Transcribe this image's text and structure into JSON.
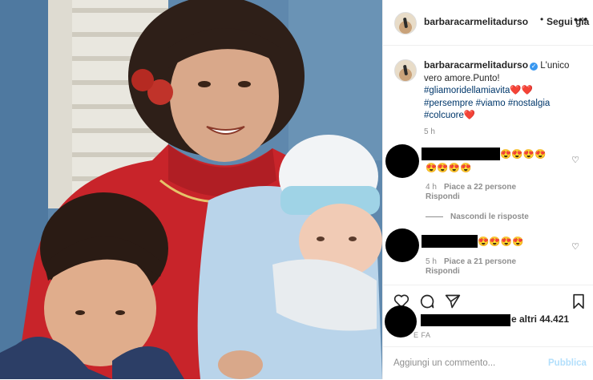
{
  "post": {
    "username": "barbaracarmelitadurso",
    "follow_separator": "•",
    "follow_label": "Segui già",
    "more_label": "•••"
  },
  "caption": {
    "username": "barbaracarmelitadurso",
    "verified_glyph": "✓",
    "text": "L'unico vero amore.Punto!",
    "hashtag1": "#gliamoridellamiavita",
    "hashtag1_emoji": "❤️❤️",
    "hashtag2": "#persempre",
    "hashtag3": "#viamo",
    "hashtag4": "#nostalgia",
    "hashtag5": "#colcuore",
    "hashtag5_emoji": "❤️",
    "time": "5 h"
  },
  "comments": [
    {
      "emoji_line1": "😍😍😍😍",
      "emoji_line2": "😍😍😍😍",
      "time": "4 h",
      "likes": "Piace a 22 persone",
      "reply": "Rispondi"
    },
    {
      "emoji_line1": "😍😍😍😍",
      "time": "5 h",
      "likes": "Piace a 21 persone",
      "reply": "Rispondi"
    }
  ],
  "hide_replies": "Nascondi le risposte",
  "likes_summary": "e altri 44.421",
  "time_ago": "E FA",
  "add_comment": {
    "placeholder": "Aggiungi un commento...",
    "publish": "Pubblica"
  },
  "colors": {
    "link": "#00376b",
    "muted": "#8e8e8e",
    "publish_disabled": "#b2dffc",
    "verified": "#3897f0"
  }
}
